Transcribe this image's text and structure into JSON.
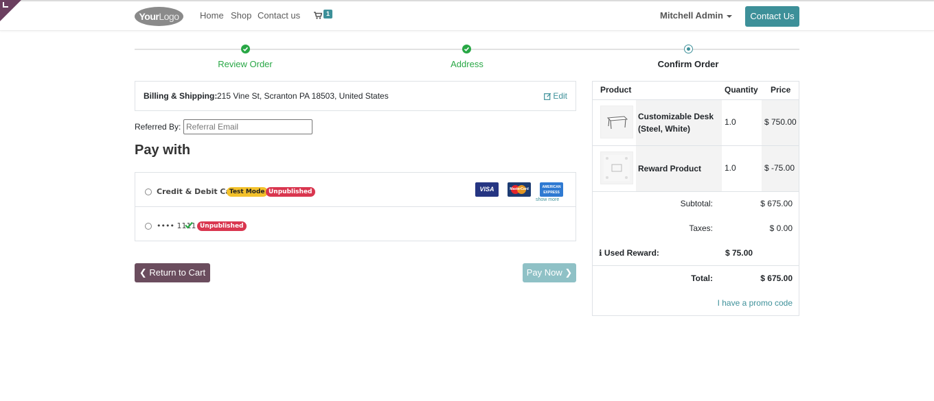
{
  "header": {
    "logo_bold": "Your",
    "logo_light": "Logo",
    "nav": [
      "Home",
      "Shop",
      "Contact us"
    ],
    "cart_count": "1",
    "user": "Mitchell Admin",
    "contact_button": "Contact Us"
  },
  "steps": [
    {
      "label": "Review Order",
      "state": "done"
    },
    {
      "label": "Address",
      "state": "done"
    },
    {
      "label": "Confirm Order",
      "state": "current"
    }
  ],
  "billing": {
    "label": "Billing & Shipping:",
    "address": "215 Vine St, Scranton PA 18503, United States",
    "edit": "Edit"
  },
  "referral": {
    "label": "Referred By:",
    "placeholder": "Referral Email"
  },
  "pay_title": "Pay with",
  "payment_methods": [
    {
      "name": "Credit & Debit Card",
      "badges": [
        "Test Mode",
        "Unpublished"
      ],
      "cards": [
        "VISA",
        "MasterCard",
        "AMERICAN EXPRESS"
      ],
      "show_more": "show more"
    },
    {
      "name": "•••• 1111",
      "badges": [
        "Unpublished"
      ]
    }
  ],
  "buttons": {
    "return": "Return to Cart",
    "pay": "Pay Now"
  },
  "summary": {
    "headers": {
      "product": "Product",
      "quantity": "Quantity",
      "price": "Price"
    },
    "items": [
      {
        "name": "Customizable Desk (Steel, White)",
        "qty": "1.0",
        "price": "$ 750.00"
      },
      {
        "name": "Reward Product",
        "qty": "1.0",
        "price": "$ -75.00"
      }
    ],
    "subtotal_label": "Subtotal:",
    "subtotal": "$ 675.00",
    "taxes_label": "Taxes:",
    "taxes": "$ 0.00",
    "reward_label": "Used Reward:",
    "reward": "$ 75.00",
    "total_label": "Total:",
    "total": "$ 675.00",
    "promo": "I have a promo code"
  },
  "colors": {
    "primary": "#3d9099",
    "secondary": "#6b4d5e",
    "success": "#28a745",
    "danger": "#d9364f",
    "warning": "#f3c12b"
  }
}
